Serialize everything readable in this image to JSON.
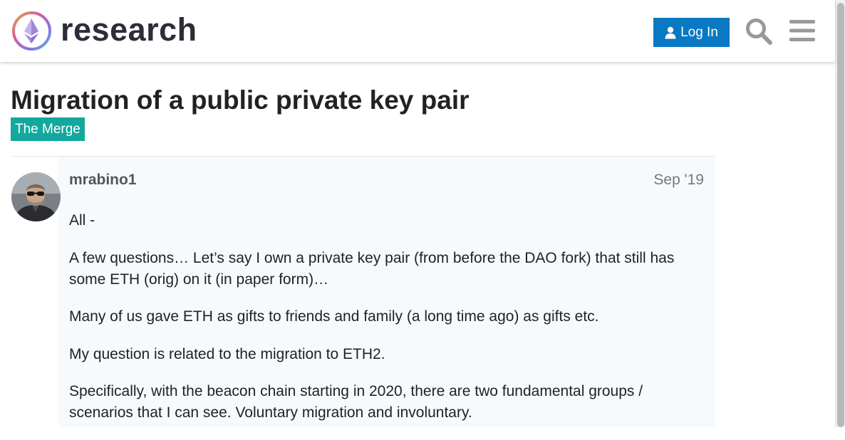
{
  "header": {
    "site_name": "research",
    "login_label": "Log In",
    "search_icon": "search-icon",
    "menu_icon": "hamburger-menu-icon",
    "accent_color": "#0a78c2"
  },
  "topic": {
    "title": "Migration of a public private key pair",
    "category": "The Merge",
    "category_color": "#12a89d"
  },
  "post": {
    "username": "mrabino1",
    "date": "Sep '19",
    "paragraphs": [
      "All -",
      "A few questions… Let’s say I own a private key pair (from before the DAO fork) that still has some ETH (orig) on it (in paper form)…",
      "Many of us gave ETH as gifts to friends and family (a long time ago) as gifts etc.",
      "My question is related to the migration to ETH2.",
      "Specifically, with the beacon chain starting in 2020, there are two fundamental groups / scenarios that I can see. Voluntary migration and involuntary."
    ]
  }
}
